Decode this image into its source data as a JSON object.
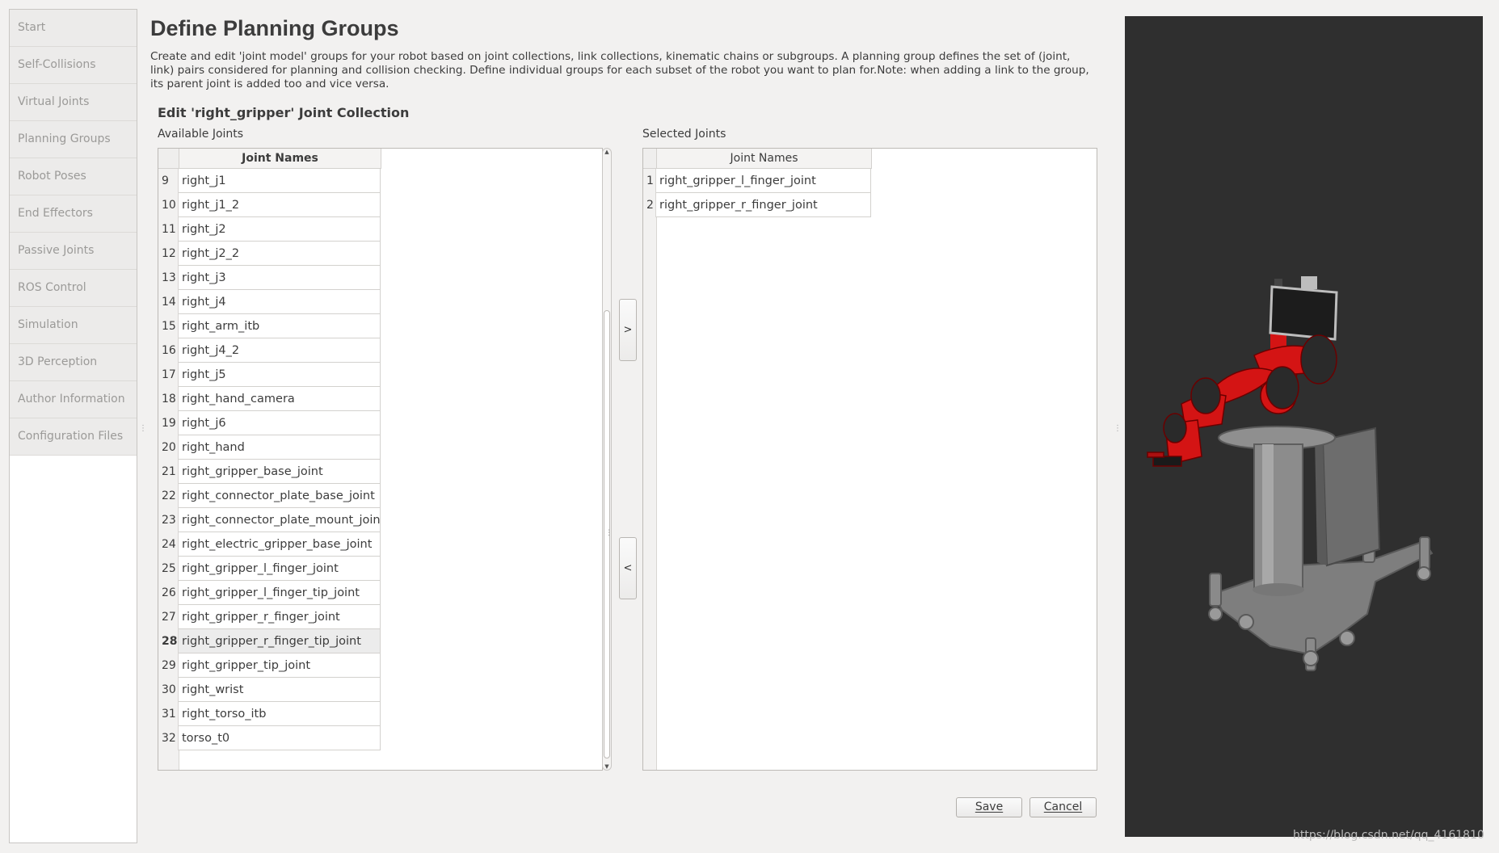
{
  "sidebar": {
    "items": [
      {
        "label": "Start"
      },
      {
        "label": "Self-Collisions"
      },
      {
        "label": "Virtual Joints"
      },
      {
        "label": "Planning Groups"
      },
      {
        "label": "Robot Poses"
      },
      {
        "label": "End Effectors"
      },
      {
        "label": "Passive Joints"
      },
      {
        "label": "ROS Control"
      },
      {
        "label": "Simulation"
      },
      {
        "label": "3D Perception"
      },
      {
        "label": "Author Information"
      },
      {
        "label": "Configuration Files"
      }
    ]
  },
  "header": {
    "title": "Define Planning Groups",
    "description": "Create and edit 'joint model' groups for your robot based on joint collections, link collections, kinematic chains or subgroups. A planning group defines the set of (joint, link) pairs considered for planning and collision checking. Define individual groups for each subset of the robot you want to plan for.Note: when adding a link to the group, its parent joint is added too and vice versa."
  },
  "editor": {
    "section_title": "Edit 'right_gripper' Joint Collection",
    "available_label": "Available Joints",
    "selected_label": "Selected Joints",
    "available": {
      "column_header": "Joint Names",
      "selected_row": "28",
      "rows": [
        {
          "num": "9",
          "name": "right_j1"
        },
        {
          "num": "10",
          "name": "right_j1_2"
        },
        {
          "num": "11",
          "name": "right_j2"
        },
        {
          "num": "12",
          "name": "right_j2_2"
        },
        {
          "num": "13",
          "name": "right_j3"
        },
        {
          "num": "14",
          "name": "right_j4"
        },
        {
          "num": "15",
          "name": "right_arm_itb"
        },
        {
          "num": "16",
          "name": "right_j4_2"
        },
        {
          "num": "17",
          "name": "right_j5"
        },
        {
          "num": "18",
          "name": "right_hand_camera"
        },
        {
          "num": "19",
          "name": "right_j6"
        },
        {
          "num": "20",
          "name": "right_hand"
        },
        {
          "num": "21",
          "name": "right_gripper_base_joint"
        },
        {
          "num": "22",
          "name": "right_connector_plate_base_joint"
        },
        {
          "num": "23",
          "name": "right_connector_plate_mount_joint"
        },
        {
          "num": "24",
          "name": "right_electric_gripper_base_joint"
        },
        {
          "num": "25",
          "name": "right_gripper_l_finger_joint"
        },
        {
          "num": "26",
          "name": "right_gripper_l_finger_tip_joint"
        },
        {
          "num": "27",
          "name": "right_gripper_r_finger_joint"
        },
        {
          "num": "28",
          "name": "right_gripper_r_finger_tip_joint"
        },
        {
          "num": "29",
          "name": "right_gripper_tip_joint"
        },
        {
          "num": "30",
          "name": "right_wrist"
        },
        {
          "num": "31",
          "name": "right_torso_itb"
        },
        {
          "num": "32",
          "name": "torso_t0"
        }
      ]
    },
    "selected": {
      "column_header": "Joint Names",
      "rows": [
        {
          "num": "1",
          "name": "right_gripper_l_finger_joint"
        },
        {
          "num": "2",
          "name": "right_gripper_r_finger_joint"
        }
      ]
    },
    "add_button": ">",
    "remove_button": "<"
  },
  "buttons": {
    "save": "Save",
    "cancel": "Cancel"
  },
  "viewport": {
    "background": "#2f2f2f",
    "robot_accent": "#d41414"
  },
  "watermark": "https://blog.csdn.net/qq_4161810"
}
